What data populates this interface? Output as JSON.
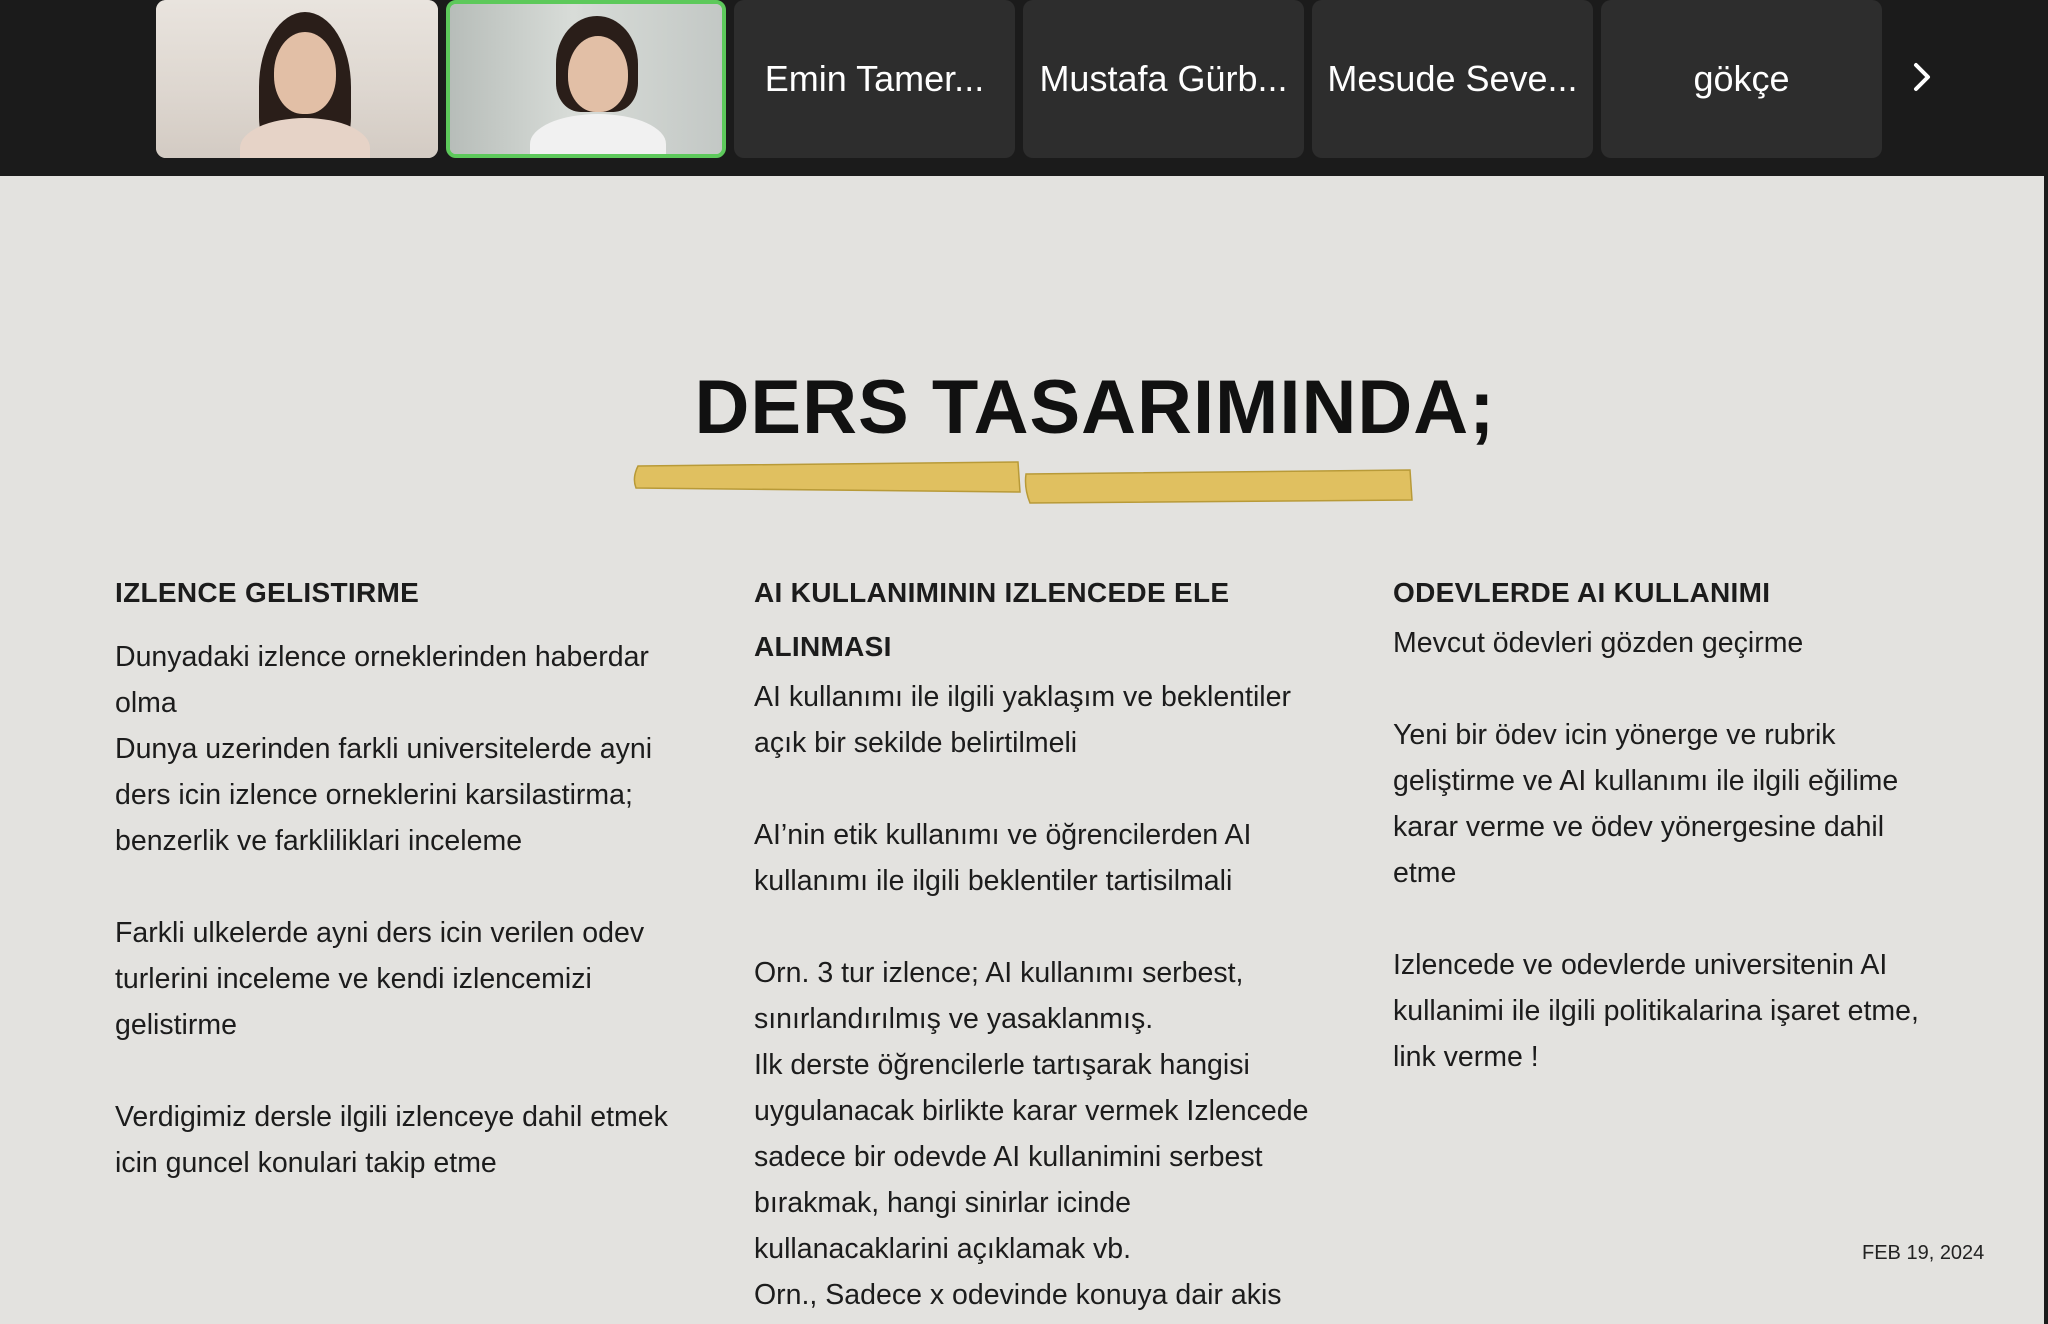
{
  "participants": {
    "names": [
      "Emin Tamer...",
      "Mustafa Gürb...",
      "Mesude Seve...",
      "gökçe"
    ],
    "next_icon": "chevron-right-icon",
    "speaking_color": "#5dc95b"
  },
  "slide": {
    "title": "DERS TASARIMINDA;",
    "highlight_color": "#e0c060",
    "columns": [
      {
        "heading": "IZLENCE GELISTIRME",
        "paragraphs": [
          "Dunyadaki izlence orneklerinden haberdar olma\nDunya uzerinden farkli universitelerde ayni ders icin izlence orneklerini karsilastirma; benzerlik ve farkliliklari inceleme",
          "Farkli ulkelerde ayni ders icin verilen odev turlerini inceleme ve kendi izlencemizi gelistirme",
          "Verdigimiz dersle ilgili izlenceye dahil etmek icin guncel konulari takip etme"
        ]
      },
      {
        "heading": "AI KULLANIMININ IZLENCEDE ELE ALINMASI",
        "paragraphs": [
          "AI kullanımı ile ilgili yaklaşım ve beklentiler açık bir sekilde belirtilmeli",
          "AI’nin etik kullanımı ve öğrencilerden AI kullanımı ile ilgili beklentiler tartisilmali",
          "Orn. 3 tur izlence; AI kullanımı serbest, sınırlandırılmış ve yasaklanmış.\nIlk derste öğrencilerle tartışarak hangisi uygulanacak birlikte karar vermek Izlencede sadece bir odevde AI kullanimini serbest bırakmak, hangi sinirlar icinde kullanacaklarini açıklamak vb.\nOrn., Sadece x odevinde konuya dair akis ve"
        ]
      },
      {
        "heading": "ODEVLERDE AI KULLANIMI",
        "paragraphs": [
          "Mevcut ödevleri gözden geçirme",
          "Yeni bir ödev icin yönerge ve rubrik geliştirme ve AI kullanımı ile ilgili eğilime karar verme ve ödev yönergesine dahil etme",
          "Izlencede ve odevlerde universitenin AI kullanimi ile ilgili politikalarina işaret etme, link verme !"
        ]
      }
    ],
    "date": "FEB 19, 2024"
  }
}
